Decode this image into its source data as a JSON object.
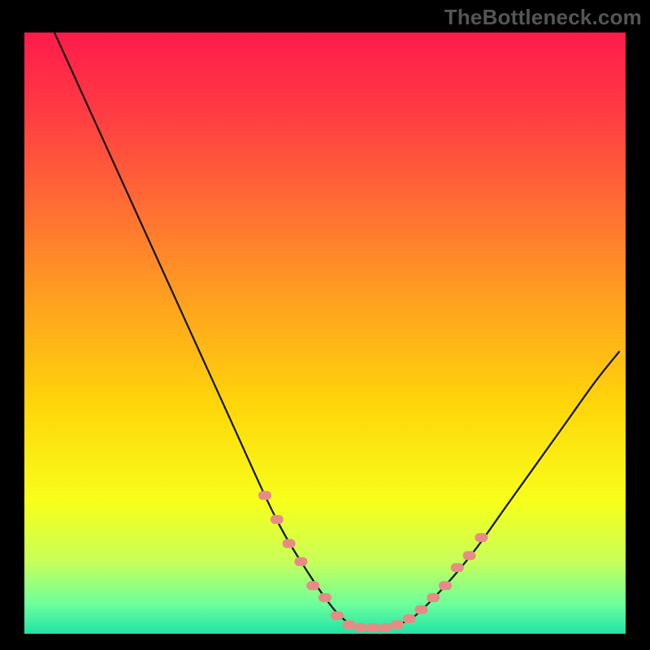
{
  "watermark": "TheBottleneck.com",
  "chart_data": {
    "type": "line",
    "title": "",
    "xlabel": "",
    "ylabel": "",
    "xlim": [
      0,
      100
    ],
    "ylim": [
      0,
      100
    ],
    "series": [
      {
        "name": "curve",
        "x": [
          5,
          10,
          15,
          20,
          25,
          30,
          35,
          40,
          43,
          46,
          50,
          53,
          56,
          60,
          62,
          65,
          70,
          75,
          80,
          85,
          90,
          95,
          99
        ],
        "y": [
          100,
          89,
          78,
          67,
          56,
          45,
          34,
          23,
          17,
          12,
          6,
          2.5,
          1,
          1,
          1.5,
          3,
          8,
          14,
          21,
          28,
          35,
          42,
          47
        ]
      }
    ],
    "markers_on_curve": [
      {
        "x": 40,
        "y": 23
      },
      {
        "x": 42,
        "y": 19
      },
      {
        "x": 44,
        "y": 15
      },
      {
        "x": 46,
        "y": 12
      },
      {
        "x": 48,
        "y": 8
      },
      {
        "x": 50,
        "y": 6
      },
      {
        "x": 52,
        "y": 3
      },
      {
        "x": 54,
        "y": 1.5
      },
      {
        "x": 56,
        "y": 1
      },
      {
        "x": 58,
        "y": 1
      },
      {
        "x": 60,
        "y": 1
      },
      {
        "x": 62,
        "y": 1.5
      },
      {
        "x": 64,
        "y": 2.5
      },
      {
        "x": 66,
        "y": 4
      },
      {
        "x": 68,
        "y": 6
      },
      {
        "x": 70,
        "y": 8
      },
      {
        "x": 72,
        "y": 11
      },
      {
        "x": 74,
        "y": 13
      },
      {
        "x": 76,
        "y": 16
      }
    ],
    "gradient_stops": [
      {
        "offset": 0.0,
        "color": "#ff1b4b"
      },
      {
        "offset": 0.12,
        "color": "#ff3844"
      },
      {
        "offset": 0.28,
        "color": "#ff6a35"
      },
      {
        "offset": 0.45,
        "color": "#ffa21f"
      },
      {
        "offset": 0.62,
        "color": "#ffd60a"
      },
      {
        "offset": 0.78,
        "color": "#f7ff1a"
      },
      {
        "offset": 0.88,
        "color": "#c7ff59"
      },
      {
        "offset": 0.95,
        "color": "#6eff9b"
      },
      {
        "offset": 1.0,
        "color": "#20e3a6"
      }
    ]
  }
}
